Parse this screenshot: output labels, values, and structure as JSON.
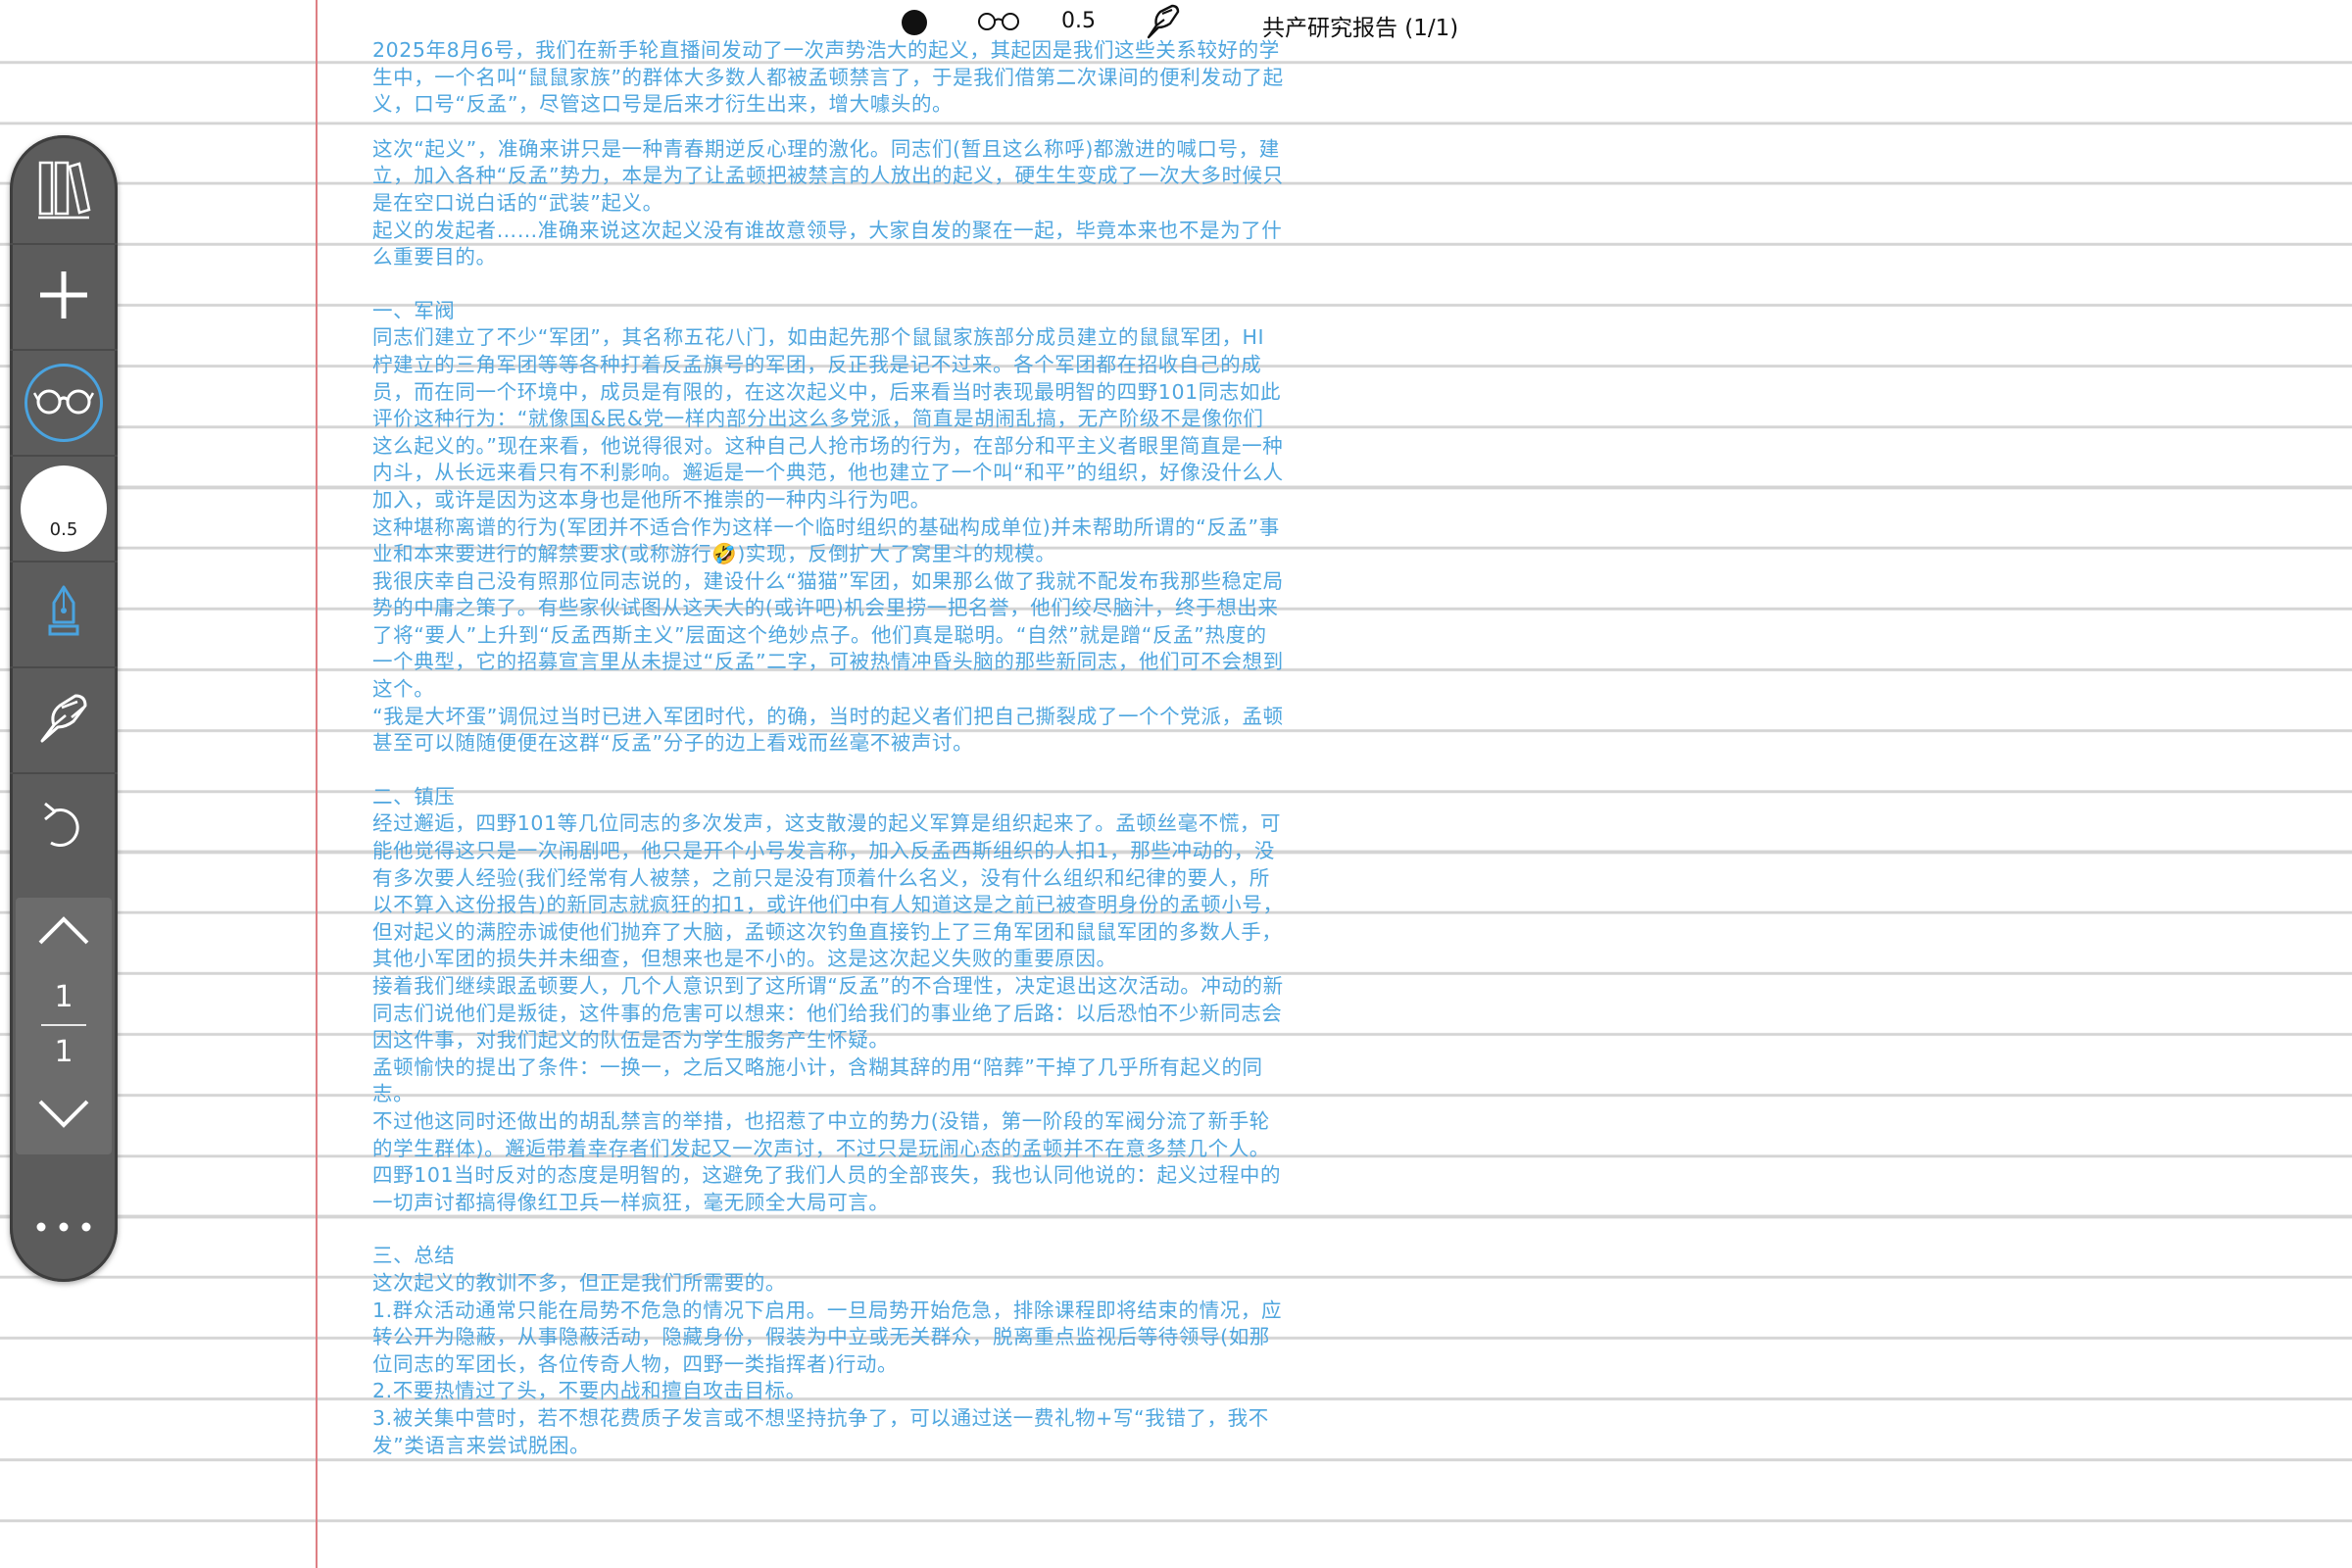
{
  "topbar": {
    "pen_size": "0.5",
    "doc_title": "共产研究报告 (1/1)"
  },
  "toolbar": {
    "stroke_size": "0.5",
    "page_current": "1",
    "page_total": "1",
    "active_tool": "glasses",
    "accent_color": "#4aa3df"
  },
  "note": {
    "paragraphs": [
      "2025年8月6号，我们在新手轮直播间发动了一次声势浩大的起义，其起因是我们这些关系较好的学生中，一个名叫“鼠鼠家族”的群体大多数人都被孟顿禁言了，于是我们借第二次课间的便利发动了起义，口号“反孟”，尽管这口号是后来才衍生出来，增大噱头的。",
      "这次“起义”，准确来讲只是一种青春期逆反心理的激化。同志们(暂且这么称呼)都激进的喊口号，建立，加入各种“反孟”势力，本是为了让孟顿把被禁言的人放出的起义，硬生生变成了一次大多时候只是在空口说白话的“武装”起义。",
      "起义的发起者……准确来说这次起义没有谁故意领导，大家自发的聚在一起，毕竟本来也不是为了什么重要目的。",
      "一、军阀",
      "同志们建立了不少“军团”，其名称五花八门，如由起先那个鼠鼠家族部分成员建立的鼠鼠军团，HI柠建立的三角军团等等各种打着反孟旗号的军团，反正我是记不过来。各个军团都在招收自己的成员，而在同一个环境中，成员是有限的，在这次起义中，后来看当时表现最明智的四野101同志如此评价这种行为：“就像国&民&党一样内部分出这么多党派，简直是胡闹乱搞，无产阶级不是像你们这么起义的。”现在来看，他说得很对。这种自己人抢市场的行为，在部分和平主义者眼里简直是一种内斗，从长远来看只有不利影响。邂逅是一个典范，他也建立了一个叫“和平”的组织，好像没什么人加入，或许是因为这本身也是他所不推崇的一种内斗行为吧。",
      "这种堪称离谱的行为(军团并不适合作为这样一个临时组织的基础构成单位)并未帮助所谓的“反孟”事业和本来要进行的解禁要求(或称游行🤣)实现，反倒扩大了窝里斗的规模。",
      "我很庆幸自己没有照那位同志说的，建设什么“猫猫”军团，如果那么做了我就不配发布我那些稳定局势的中庸之策了。有些家伙试图从这天大的(或许吧)机会里捞一把名誉，他们绞尽脑汁，终于想出来了将“要人”上升到“反孟西斯主义”层面这个绝妙点子。他们真是聪明。“自然”就是蹭“反孟”热度的一个典型，它的招募宣言里从未提过“反孟”二字，可被热情冲昏头脑的那些新同志，他们可不会想到这个。",
      "“我是大坏蛋”调侃过当时已进入军团时代，的确，当时的起义者们把自己撕裂成了一个个党派，孟顿甚至可以随随便便在这群“反孟”分子的边上看戏而丝毫不被声讨。",
      "二、镇压",
      "经过邂逅，四野101等几位同志的多次发声，这支散漫的起义军算是组织起来了。孟顿丝毫不慌，可能他觉得这只是一次闹剧吧，他只是开个小号发言称，加入反孟西斯组织的人扣1，那些冲动的，没有多次要人经验(我们经常有人被禁，之前只是没有顶着什么名义，没有什么组织和纪律的要人，所以不算入这份报告)的新同志就疯狂的扣1，或许他们中有人知道这是之前已被查明身份的孟顿小号，但对起义的满腔赤诚使他们抛弃了大脑，孟顿这次钓鱼直接钓上了三角军团和鼠鼠军团的多数人手，其他小军团的损失并未细查，但想来也是不小的。这是这次起义失败的重要原因。",
      "接着我们继续跟孟顿要人，几个人意识到了这所谓“反孟”的不合理性，决定退出这次活动。冲动的新同志们说他们是叛徒，这件事的危害可以想来：他们给我们的事业绝了后路：以后恐怕不少新同志会因这件事，对我们起义的队伍是否为学生服务产生怀疑。",
      "孟顿愉快的提出了条件：一换一，之后又略施小计，含糊其辞的用“陪葬”干掉了几乎所有起义的同志。",
      "不过他这同时还做出的胡乱禁言的举措，也招惹了中立的势力(没错，第一阶段的军阀分流了新手轮的学生群体)。邂逅带着幸存者们发起又一次声讨，不过只是玩闹心态的孟顿并不在意多禁几个人。四野101当时反对的态度是明智的，这避免了我们人员的全部丧失，我也认同他说的：起义过程中的一切声讨都搞得像红卫兵一样疯狂，毫无顾全大局可言。",
      "三、总结",
      "这次起义的教训不多，但正是我们所需要的。",
      "1.群众活动通常只能在局势不危急的情况下启用。一旦局势开始危急，排除课程即将结束的情况，应转公开为隐蔽，从事隐蔽活动，隐藏身份，假装为中立或无关群众，脱离重点监视后等待领导(如那位同志的军团长，各位传奇人物，四野一类指挥者)行动。",
      "2.不要热情过了头，不要内战和擅自攻击目标。",
      "3.被关集中营时，若不想花费质子发言或不想坚持抗争了，可以通过送一费礼物+写“我错了，我不发”类语言来尝试脱困。"
    ]
  }
}
